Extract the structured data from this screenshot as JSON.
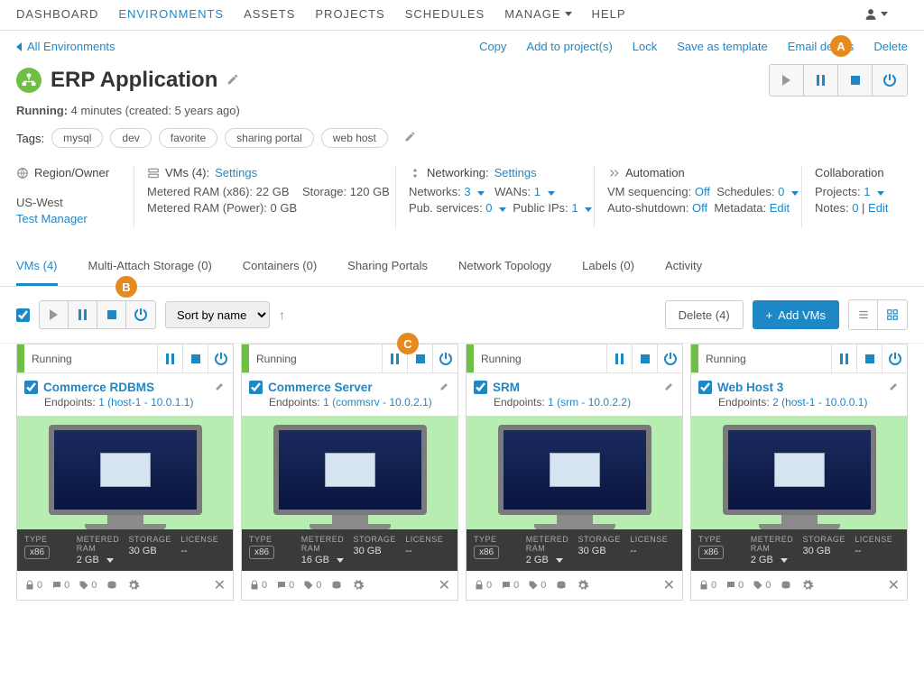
{
  "nav": {
    "items": [
      "DASHBOARD",
      "ENVIRONMENTS",
      "ASSETS",
      "PROJECTS",
      "SCHEDULES",
      "MANAGE",
      "HELP"
    ],
    "active_index": 1
  },
  "breadcrumb": "All Environments",
  "page_actions": [
    "Copy",
    "Add to project(s)",
    "Lock",
    "Save as template",
    "Email details",
    "Delete"
  ],
  "title": "ERP Application",
  "status_label": "Running:",
  "status_duration": "4 minutes",
  "status_created": "(created: 5 years ago)",
  "tags_label": "Tags:",
  "tags": [
    "mysql",
    "dev",
    "favorite",
    "sharing portal",
    "web host"
  ],
  "annotations": {
    "A": "A",
    "B": "B",
    "C": "C"
  },
  "info": {
    "region": {
      "hd": "Region/Owner",
      "region": "US-West",
      "owner": "Test Manager"
    },
    "vms": {
      "hd_prefix": "VMs (4):",
      "hd_link": "Settings",
      "ram_x86_label": "Metered RAM (x86):",
      "ram_x86": "22 GB",
      "storage_label": "Storage:",
      "storage": "120 GB",
      "ram_power_label": "Metered RAM (Power):",
      "ram_power": "0 GB"
    },
    "net": {
      "hd_prefix": "Networking:",
      "hd_link": "Settings",
      "networks_label": "Networks:",
      "networks": "3",
      "wans_label": "WANs:",
      "wans": "1",
      "pub_label": "Pub. services:",
      "pub": "0",
      "ips_label": "Public IPs:",
      "ips": "1"
    },
    "auto": {
      "hd": "Automation",
      "seq_label": "VM sequencing:",
      "seq": "Off",
      "sched_label": "Schedules:",
      "sched": "0",
      "asd_label": "Auto-shutdown:",
      "asd": "Off",
      "meta_label": "Metadata:",
      "meta": "Edit"
    },
    "collab": {
      "hd": "Collaboration",
      "proj_label": "Projects:",
      "proj": "1",
      "notes_label": "Notes:",
      "notes": "0",
      "notes_edit": "Edit"
    }
  },
  "tabs": [
    {
      "label": "VMs (4)",
      "active": true
    },
    {
      "label": "Multi-Attach Storage (0)"
    },
    {
      "label": "Containers (0)"
    },
    {
      "label": "Sharing Portals"
    },
    {
      "label": "Network Topology"
    },
    {
      "label": "Labels (0)"
    },
    {
      "label": "Activity"
    }
  ],
  "toolbar": {
    "sort": "Sort by name",
    "delete": "Delete (4)",
    "add": "Add VMs"
  },
  "spec_headers": {
    "type": "TYPE",
    "ram": "METERED RAM",
    "storage": "STORAGE",
    "license": "LICENSE"
  },
  "vms": [
    {
      "state": "Running",
      "name": "Commerce RDBMS",
      "endpoints_label": "Endpoints:",
      "endpoints": "1 (host-1 - 10.0.1.1)",
      "type": "x86",
      "ram": "2 GB",
      "storage": "30 GB",
      "license": "--",
      "lock": "0",
      "chat": "0",
      "tag": "0"
    },
    {
      "state": "Running",
      "name": "Commerce Server",
      "endpoints_label": "Endpoints:",
      "endpoints": "1 (commsrv - 10.0.2.1)",
      "type": "x86",
      "ram": "16 GB",
      "storage": "30 GB",
      "license": "--",
      "lock": "0",
      "chat": "0",
      "tag": "0"
    },
    {
      "state": "Running",
      "name": "SRM",
      "endpoints_label": "Endpoints:",
      "endpoints": "1 (srm - 10.0.2.2)",
      "type": "x86",
      "ram": "2 GB",
      "storage": "30 GB",
      "license": "--",
      "lock": "0",
      "chat": "0",
      "tag": "0"
    },
    {
      "state": "Running",
      "name": "Web Host 3",
      "endpoints_label": "Endpoints:",
      "endpoints": "2 (host-1 - 10.0.0.1)",
      "type": "x86",
      "ram": "2 GB",
      "storage": "30 GB",
      "license": "--",
      "lock": "0",
      "chat": "0",
      "tag": "0"
    }
  ]
}
